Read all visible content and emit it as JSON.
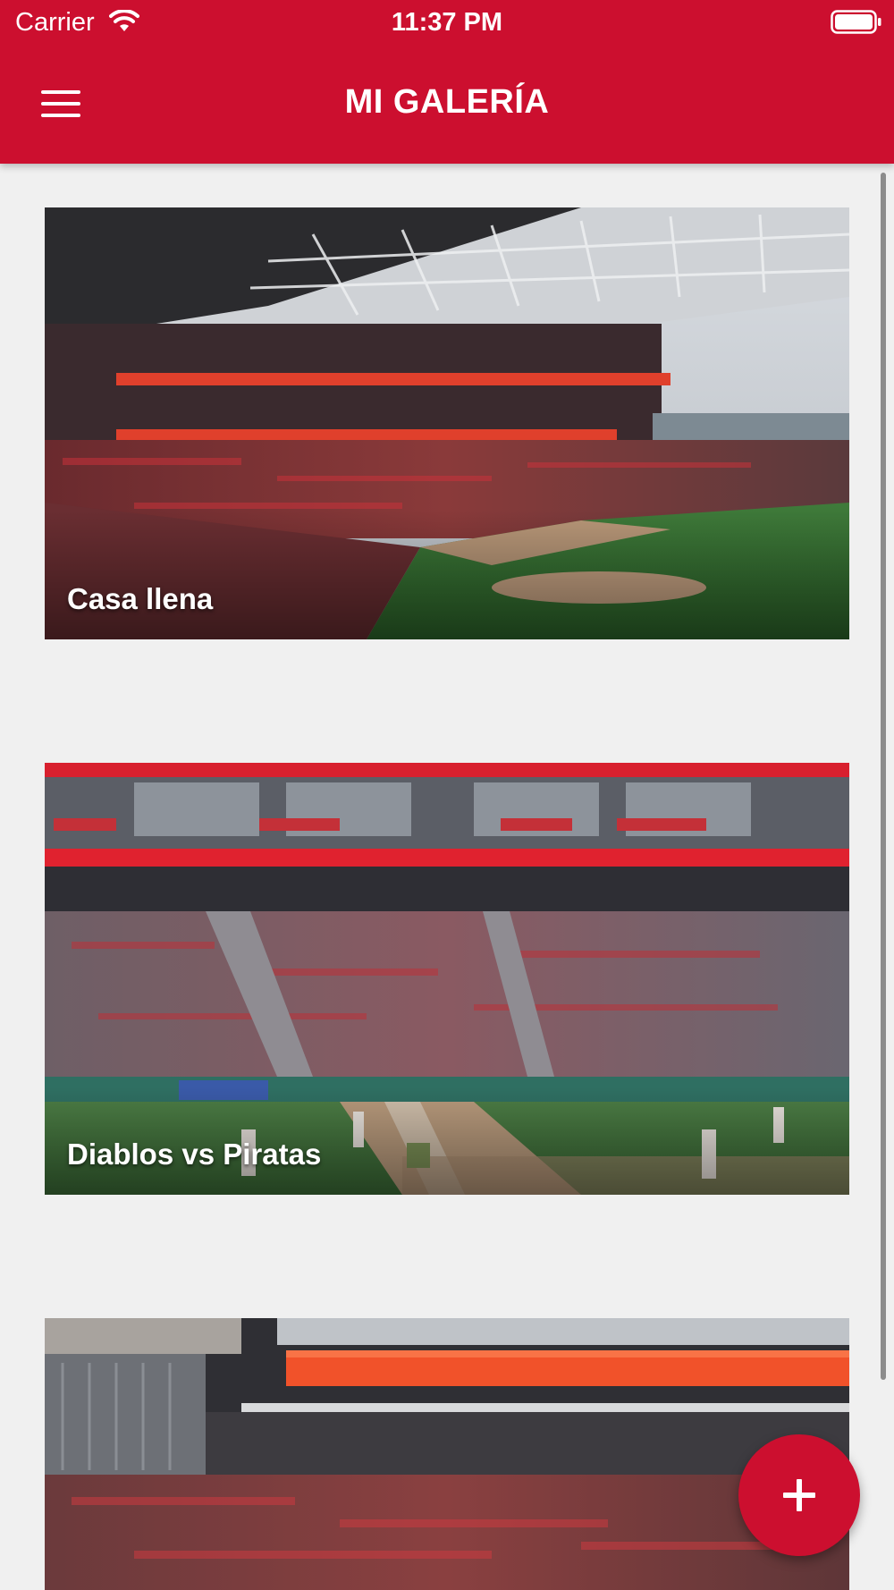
{
  "status_bar": {
    "carrier": "Carrier",
    "time": "11:37 PM"
  },
  "header": {
    "title": "MI GALERÍA",
    "menu_icon": "hamburger-menu-icon"
  },
  "gallery": {
    "items": [
      {
        "label": "Casa llena",
        "image": "stadium-full-crowd-photo"
      },
      {
        "label": "Diablos vs Piratas",
        "image": "baseball-game-photo"
      },
      {
        "label": "",
        "image": "stadium-stands-photo"
      }
    ]
  },
  "fab": {
    "icon": "plus-icon"
  },
  "colors": {
    "primary": "#cc0f2f",
    "background": "#f0f0f0"
  }
}
